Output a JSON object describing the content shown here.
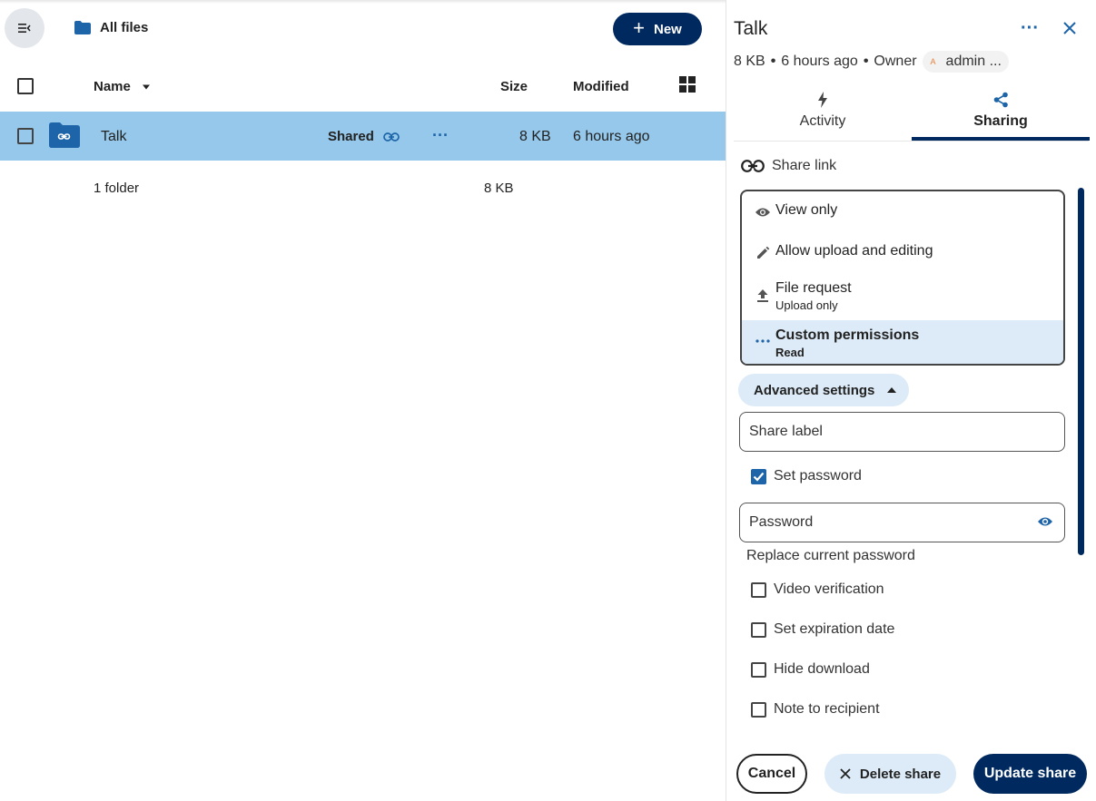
{
  "files": {
    "breadcrumb": "All files",
    "new_button": "New",
    "columns": {
      "name": "Name",
      "size": "Size",
      "modified": "Modified"
    },
    "rows": [
      {
        "name": "Talk",
        "shared_label": "Shared",
        "size": "8 KB",
        "modified": "6 hours ago"
      }
    ],
    "summary": {
      "count": "1 folder",
      "total": "8 KB"
    }
  },
  "sidebar": {
    "title": "Talk",
    "meta": {
      "size": "8 KB",
      "time": "6 hours ago",
      "owner_label": "Owner",
      "owner_initial": "A",
      "owner_name": "admin ..."
    },
    "tabs": [
      {
        "label": "Activity"
      },
      {
        "label": "Sharing"
      }
    ],
    "share_link_label": "Share link",
    "permissions": [
      {
        "label": "View only",
        "icon": "eye-icon"
      },
      {
        "label": "Allow upload and editing",
        "icon": "pencil-icon"
      },
      {
        "label": "File request",
        "sub": "Upload only",
        "icon": "upload-icon"
      },
      {
        "label": "Custom permissions",
        "sub": "Read",
        "icon": "dots-icon",
        "selected": true
      }
    ],
    "advanced_settings": "Advanced settings",
    "share_label_placeholder": "Share label",
    "set_password": "Set password",
    "password_placeholder": "Password",
    "replace_password": "Replace current password",
    "options": [
      {
        "label": "Video verification",
        "checked": false
      },
      {
        "label": "Set expiration date",
        "checked": false
      },
      {
        "label": "Hide download",
        "checked": false
      },
      {
        "label": "Note to recipient",
        "checked": false
      }
    ],
    "buttons": {
      "cancel": "Cancel",
      "delete": "Delete share",
      "update": "Update share"
    }
  },
  "colors": {
    "primary": "#00295f",
    "accent": "#1d64a8",
    "selected_row": "#95c8ea",
    "light_accent": "#dcebf7"
  }
}
